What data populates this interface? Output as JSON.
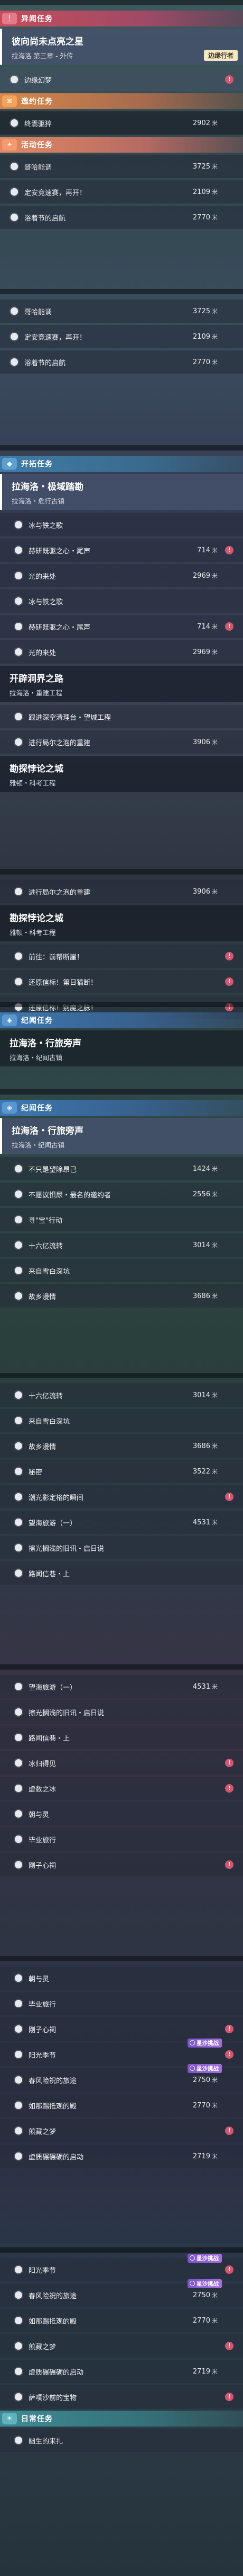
{
  "accent": {
    "anomaly": "#c84c5c",
    "invite": "#d9874a",
    "event": "#e28862",
    "trailblaze": "#3f7ca8",
    "chronicle": "#3d78b0",
    "daily": "#3f8a95",
    "badge": "#d45770",
    "pill": "#7b54c8"
  },
  "blocks": [
    {
      "items": [
        {
          "t": "cat",
          "cls": "yi",
          "icon": "!",
          "label": "异闻任务"
        },
        {
          "t": "title",
          "sel": true,
          "title": "彼向尚未点亮之星",
          "sub": "拉海洛 第三章 - 外传",
          "tag": "边缘行者"
        },
        {
          "t": "row",
          "style": "light",
          "label": "边缘幻梦",
          "badge": true
        },
        {
          "t": "cat",
          "cls": "yao",
          "icon": "✉",
          "label": "邀约任务"
        },
        {
          "t": "row",
          "style": "dark",
          "label": "终焉驱猝",
          "value": "2902",
          "unit": "米"
        },
        {
          "t": "cat",
          "cls": "huo",
          "icon": "✦",
          "label": "活动任务"
        },
        {
          "t": "row",
          "style": "glass",
          "label": "哥哈能调",
          "value": "3725",
          "unit": "米"
        },
        {
          "t": "row",
          "style": "glass",
          "label": "定安竞速赛，再开！",
          "value": "2109",
          "unit": "米"
        },
        {
          "t": "row",
          "style": "glass",
          "label": "浴着节的启航",
          "value": "2770",
          "unit": "米"
        }
      ]
    },
    {
      "items": [
        {
          "t": "row",
          "style": "glass",
          "label": "哥哈能调",
          "value": "3725",
          "unit": "米"
        },
        {
          "t": "row",
          "style": "glass",
          "label": "定安竞速赛，再开！",
          "value": "2109",
          "unit": "米"
        },
        {
          "t": "row",
          "style": "glass",
          "label": "浴着节的启航",
          "value": "2770",
          "unit": "米"
        }
      ]
    },
    {
      "items": [
        {
          "t": "cat",
          "cls": "kai",
          "icon": "◆",
          "label": "开拓任务"
        },
        {
          "t": "title",
          "sel": true,
          "title": "拉海洛・极域踏勘",
          "sub": "拉海洛・危行古镇"
        },
        {
          "t": "row",
          "style": "glass",
          "indent": true,
          "label": "冰与铁之歌"
        },
        {
          "t": "row",
          "style": "glass",
          "indent": true,
          "label": "赫研既驱之心・尾声",
          "value": "714",
          "unit": "米",
          "badge": true
        },
        {
          "t": "row",
          "style": "glass",
          "indent": true,
          "label": "光的来处",
          "value": "2969",
          "unit": "米"
        },
        {
          "t": "row",
          "style": "glass",
          "indent": true,
          "label": "冰与铁之歌"
        },
        {
          "t": "row",
          "style": "glass",
          "indent": true,
          "label": "赫研既驱之心・尾声",
          "value": "714",
          "unit": "米",
          "badge": true
        },
        {
          "t": "row",
          "style": "glass",
          "indent": true,
          "label": "光的来处",
          "value": "2969",
          "unit": "米"
        },
        {
          "t": "title",
          "sel": false,
          "title": "开辟洞界之路",
          "sub": "拉海洛・重建工程"
        },
        {
          "t": "row",
          "style": "glass",
          "indent": true,
          "label": "跟进深空清理台・望城工程"
        },
        {
          "t": "row",
          "style": "glass",
          "indent": true,
          "label": "进行局尔之泡的重建",
          "value": "3906",
          "unit": "米"
        },
        {
          "t": "title",
          "sel": false,
          "title": "勘探悖论之城",
          "sub": "雅顿・科考工程"
        }
      ]
    },
    {
      "items": [
        {
          "t": "row",
          "style": "glass",
          "indent": true,
          "label": "进行局尔之泡的重建",
          "value": "3906",
          "unit": "米"
        },
        {
          "t": "title",
          "sel": false,
          "title": "勘探悖论之城",
          "sub": "雅顿・科考工程"
        },
        {
          "t": "row",
          "style": "glass",
          "indent": true,
          "label": "前往：前帮断崖！",
          "badge": true
        },
        {
          "t": "row",
          "style": "glass",
          "indent": true,
          "label": "还原信标！第日猫断！",
          "badge": true
        },
        {
          "t": "row",
          "style": "glass",
          "indent": true,
          "label": "还原信标！别魔之脉！",
          "badge": true
        }
      ]
    },
    {
      "items": [
        {
          "t": "cat",
          "cls": "ji",
          "icon": "◈",
          "label": "纪闻任务"
        },
        {
          "t": "title",
          "sel": false,
          "title": "拉海洛・行旅旁声",
          "sub": "拉海洛・纪闻古镇"
        }
      ]
    },
    {
      "items": [
        {
          "t": "cat",
          "cls": "ji",
          "icon": "◈",
          "label": "纪闻任务"
        },
        {
          "t": "title",
          "sel": true,
          "title": "拉海洛・行旅旁声",
          "sub": "拉海洛・纪闻古镇"
        },
        {
          "t": "row",
          "style": "glass",
          "indent": true,
          "label": "不只是望除昂己",
          "value": "1424",
          "unit": "米"
        },
        {
          "t": "row",
          "style": "glass",
          "indent": true,
          "label": "不愿议惧尿・最名的邀约者",
          "value": "2556",
          "unit": "米"
        },
        {
          "t": "row",
          "style": "glass",
          "indent": true,
          "label": "寻\"宝\"行动"
        },
        {
          "t": "row",
          "style": "glass",
          "indent": true,
          "label": "十六亿流转",
          "value": "3014",
          "unit": "米"
        },
        {
          "t": "row",
          "style": "glass",
          "indent": true,
          "label": "来自雪白深坑"
        },
        {
          "t": "row",
          "style": "glass",
          "indent": true,
          "label": "故乡漫情",
          "value": "3686",
          "unit": "米"
        }
      ]
    },
    {
      "items": [
        {
          "t": "row",
          "style": "glass",
          "indent": true,
          "label": "十六亿流转",
          "value": "3014",
          "unit": "米"
        },
        {
          "t": "row",
          "style": "glass",
          "indent": true,
          "label": "来自雪白深坑"
        },
        {
          "t": "row",
          "style": "glass",
          "indent": true,
          "label": "故乡漫情",
          "value": "3686",
          "unit": "米"
        },
        {
          "t": "row",
          "style": "glass",
          "indent": true,
          "label": "秘密",
          "value": "3522",
          "unit": "米"
        },
        {
          "t": "row",
          "style": "glass",
          "indent": true,
          "label": "潮光影定格的瞬间",
          "badge": true
        },
        {
          "t": "row",
          "style": "glass",
          "indent": true,
          "label": "望海旅游（一）",
          "value": "4531",
          "unit": "米"
        },
        {
          "t": "row",
          "style": "glass",
          "indent": true,
          "label": "擦光搁浅的旧讯・启日说"
        },
        {
          "t": "row",
          "style": "glass",
          "indent": true,
          "label": "路闻信巷・上"
        }
      ]
    },
    {
      "items": [
        {
          "t": "row",
          "style": "glass",
          "indent": true,
          "label": "望海旅游（一）",
          "value": "4531",
          "unit": "米"
        },
        {
          "t": "row",
          "style": "glass",
          "indent": true,
          "label": "擦光搁浅的旧讯・启日说"
        },
        {
          "t": "row",
          "style": "glass",
          "indent": true,
          "label": "路闻信巷・上"
        },
        {
          "t": "row",
          "style": "glass",
          "indent": true,
          "label": "冰归得见",
          "badge": true
        },
        {
          "t": "row",
          "style": "glass",
          "indent": true,
          "label": "虚数之冰",
          "badge": true
        },
        {
          "t": "row",
          "style": "glass",
          "indent": true,
          "label": "朝与灵"
        },
        {
          "t": "row",
          "style": "glass",
          "indent": true,
          "label": "毕业旅行"
        },
        {
          "t": "row",
          "style": "glass",
          "indent": true,
          "label": "刚子心祠",
          "badge": true
        }
      ]
    },
    {
      "items": [
        {
          "t": "row",
          "style": "glass",
          "indent": true,
          "label": "朝与灵"
        },
        {
          "t": "row",
          "style": "glass",
          "indent": true,
          "label": "毕业旅行"
        },
        {
          "t": "row",
          "style": "glass",
          "indent": true,
          "label": "刚子心祠",
          "badge": true
        },
        {
          "t": "row",
          "style": "glass",
          "indent": true,
          "label": "阳光季节",
          "badge": true,
          "pill": "星沙挑战"
        },
        {
          "t": "row",
          "style": "glass",
          "indent": true,
          "label": "春风险祝的旅途",
          "value": "2750",
          "unit": "米",
          "pill": "星沙挑战"
        },
        {
          "t": "row",
          "style": "glass",
          "indent": true,
          "label": "如那踢抵观的殿",
          "value": "2770",
          "unit": "米"
        },
        {
          "t": "row",
          "style": "glass",
          "indent": true,
          "label": "煎藏之梦",
          "badge": true
        },
        {
          "t": "row",
          "style": "glass",
          "indent": true,
          "label": "虚质碾碾砺的启动",
          "value": "2719",
          "unit": "米"
        }
      ]
    },
    {
      "items": [
        {
          "t": "row",
          "style": "glass",
          "indent": true,
          "label": "阳光季节",
          "badge": true,
          "pill": "星沙挑战"
        },
        {
          "t": "row",
          "style": "glass",
          "indent": true,
          "label": "春风险祝的旅途",
          "value": "2750",
          "unit": "米",
          "pill": "星沙挑战"
        },
        {
          "t": "row",
          "style": "glass",
          "indent": true,
          "label": "如那踢抵观的殿",
          "value": "2770",
          "unit": "米"
        },
        {
          "t": "row",
          "style": "glass",
          "indent": true,
          "label": "煎藏之梦",
          "badge": true
        },
        {
          "t": "row",
          "style": "glass",
          "indent": true,
          "label": "虚质碾碾砺的启动",
          "value": "2719",
          "unit": "米"
        },
        {
          "t": "row",
          "style": "glass",
          "indent": true,
          "label": "萨噗沙前的宝物",
          "badge": true
        },
        {
          "t": "cat",
          "cls": "ri",
          "icon": "☀",
          "label": "日常任务"
        },
        {
          "t": "row",
          "style": "glass",
          "indent": true,
          "label": "幽生的来扎"
        }
      ]
    }
  ]
}
